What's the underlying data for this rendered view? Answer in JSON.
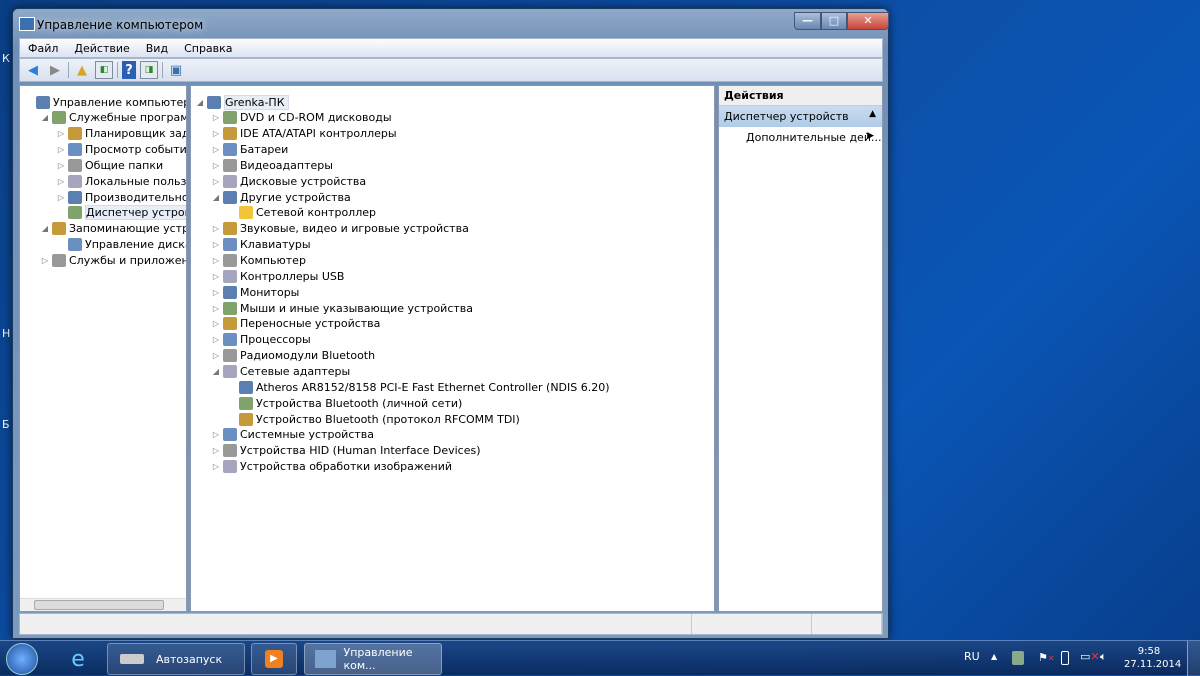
{
  "desktop": {
    "labels": [
      "К",
      "Н",
      "Б"
    ]
  },
  "window": {
    "title": "Управление компьютером",
    "minimize": "—",
    "maximize": "□",
    "close": "✕"
  },
  "menu": [
    "Файл",
    "Действие",
    "Вид",
    "Справка"
  ],
  "toolbar": {
    "icons": [
      "back-icon",
      "forward-icon",
      "up-folder-icon",
      "show-hide-tree-icon",
      "help-icon",
      "show-hide-action-pane-icon",
      "properties-icon"
    ]
  },
  "left_tree": [
    {
      "label": "Управление компьютером (л",
      "level": 0,
      "arrow": ""
    },
    {
      "label": "Служебные программы",
      "level": 1,
      "arrow": "◢"
    },
    {
      "label": "Планировщик заданий",
      "level": 2,
      "arrow": "▷"
    },
    {
      "label": "Просмотр событий",
      "level": 2,
      "arrow": "▷"
    },
    {
      "label": "Общие папки",
      "level": 2,
      "arrow": "▷"
    },
    {
      "label": "Локальные пользовате",
      "level": 2,
      "arrow": "▷"
    },
    {
      "label": "Производительность",
      "level": 2,
      "arrow": "▷"
    },
    {
      "label": "Диспетчер устройств",
      "level": 2,
      "arrow": "",
      "selected": true
    },
    {
      "label": "Запоминающие устройст",
      "level": 1,
      "arrow": "◢"
    },
    {
      "label": "Управление дисками",
      "level": 2,
      "arrow": ""
    },
    {
      "label": "Службы и приложения",
      "level": 1,
      "arrow": "▷"
    }
  ],
  "device_tree": [
    {
      "label": "Grenka-ПК",
      "level": 0,
      "arrow": "◢",
      "selected": true
    },
    {
      "label": "DVD и CD-ROM дисководы",
      "level": 1,
      "arrow": "▷"
    },
    {
      "label": "IDE ATA/ATAPI контроллеры",
      "level": 1,
      "arrow": "▷"
    },
    {
      "label": "Батареи",
      "level": 1,
      "arrow": "▷"
    },
    {
      "label": "Видеоадаптеры",
      "level": 1,
      "arrow": "▷"
    },
    {
      "label": "Дисковые устройства",
      "level": 1,
      "arrow": "▷"
    },
    {
      "label": "Другие устройства",
      "level": 1,
      "arrow": "◢"
    },
    {
      "label": "Сетевой контроллер",
      "level": 2,
      "arrow": "",
      "warning": true
    },
    {
      "label": "Звуковые, видео и игровые устройства",
      "level": 1,
      "arrow": "▷"
    },
    {
      "label": "Клавиатуры",
      "level": 1,
      "arrow": "▷"
    },
    {
      "label": "Компьютер",
      "level": 1,
      "arrow": "▷"
    },
    {
      "label": "Контроллеры USB",
      "level": 1,
      "arrow": "▷"
    },
    {
      "label": "Мониторы",
      "level": 1,
      "arrow": "▷"
    },
    {
      "label": "Мыши и иные указывающие устройства",
      "level": 1,
      "arrow": "▷"
    },
    {
      "label": "Переносные устройства",
      "level": 1,
      "arrow": "▷"
    },
    {
      "label": "Процессоры",
      "level": 1,
      "arrow": "▷"
    },
    {
      "label": "Радиомодули Bluetooth",
      "level": 1,
      "arrow": "▷"
    },
    {
      "label": "Сетевые адаптеры",
      "level": 1,
      "arrow": "◢"
    },
    {
      "label": "Atheros AR8152/8158 PCI-E Fast Ethernet Controller (NDIS 6.20)",
      "level": 2,
      "arrow": ""
    },
    {
      "label": "Устройства Bluetooth (личной сети)",
      "level": 2,
      "arrow": ""
    },
    {
      "label": "Устройство Bluetooth (протокол RFCOMM TDI)",
      "level": 2,
      "arrow": ""
    },
    {
      "label": "Системные устройства",
      "level": 1,
      "arrow": "▷"
    },
    {
      "label": "Устройства HID (Human Interface Devices)",
      "level": 1,
      "arrow": "▷"
    },
    {
      "label": "Устройства обработки изображений",
      "level": 1,
      "arrow": "▷"
    }
  ],
  "actions": {
    "header": "Действия",
    "section": "Диспетчер устройств",
    "item": "Дополнительные дей..."
  },
  "taskbar": {
    "buttons": [
      "Автозапуск",
      "Управление ком..."
    ],
    "lang": "RU",
    "time": "9:58",
    "date": "27.11.2014"
  },
  "colors": {
    "accent": "#c7d9ee",
    "close": "#c8443a"
  }
}
